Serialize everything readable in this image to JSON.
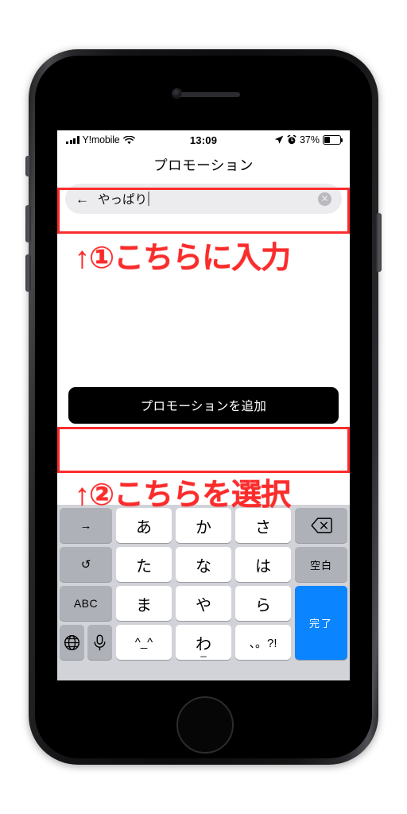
{
  "device": {
    "type": "smartphone-mockup",
    "hardware": {
      "camera": "front-camera",
      "speaker": "earpiece-speaker",
      "home_button": "home-button",
      "silent_switch": "silent-switch",
      "volume_up": "volume-up-button",
      "volume_down": "volume-down-button",
      "power": "power-button"
    }
  },
  "status_bar": {
    "signal_icon": "cellular-signal-icon",
    "carrier": "Y!mobile",
    "wifi_icon": "wifi-icon",
    "time": "13:09",
    "location_icon": "location-arrow-icon",
    "alarm_icon": "alarm-clock-icon",
    "battery_percent": "37%",
    "battery_icon": "battery-icon",
    "battery_level": 37
  },
  "app": {
    "title": "プロモーション"
  },
  "search": {
    "back_icon": "back-arrow-icon",
    "value": "やっぱり",
    "placeholder": "",
    "clear_icon": "clear-circle-icon",
    "clear_glyph": "✕"
  },
  "cta": {
    "label": "プロモーションを追加"
  },
  "annotations": [
    {
      "id": "step-1",
      "text": "↑①こちらに入力",
      "color": "#fb2c2c",
      "target": "search-field"
    },
    {
      "id": "step-2",
      "text": "↑②こちらを選択",
      "color": "#fb2c2c",
      "target": "add-promotion-button"
    }
  ],
  "keyboard": {
    "type": "japanese-kana-12key",
    "left_column": [
      {
        "name": "cursor-right-key",
        "label": "→",
        "style": "dark"
      },
      {
        "name": "undo-key",
        "label": "↺",
        "style": "dark"
      },
      {
        "name": "abc-mode-key",
        "label": "ABC",
        "style": "dark"
      }
    ],
    "bottom_left": [
      {
        "name": "globe-key",
        "label": "🌐",
        "style": "dark"
      },
      {
        "name": "dictation-key",
        "label": "🎤",
        "style": "dark"
      }
    ],
    "center_rows": [
      [
        {
          "name": "kana-a-key",
          "label": "あ"
        },
        {
          "name": "kana-ka-key",
          "label": "か"
        },
        {
          "name": "kana-sa-key",
          "label": "さ"
        }
      ],
      [
        {
          "name": "kana-ta-key",
          "label": "た"
        },
        {
          "name": "kana-na-key",
          "label": "な"
        },
        {
          "name": "kana-ha-key",
          "label": "は"
        }
      ],
      [
        {
          "name": "kana-ma-key",
          "label": "ま"
        },
        {
          "name": "kana-ya-key",
          "label": "や"
        },
        {
          "name": "kana-ra-key",
          "label": "ら"
        }
      ],
      [
        {
          "name": "emoticon-key",
          "label": "^_^"
        },
        {
          "name": "kana-wa-key",
          "label": "わ",
          "sub": "_"
        },
        {
          "name": "punctuation-key",
          "label": "、。?!"
        }
      ]
    ],
    "right_column": [
      {
        "name": "backspace-key",
        "label": "⌫",
        "style": "dark"
      },
      {
        "name": "space-key",
        "label": "空白",
        "style": "dark"
      },
      {
        "name": "done-key",
        "label": "完了",
        "style": "blue"
      }
    ]
  },
  "colors": {
    "accent_blue": "#0a84ff",
    "annotation_red": "#fb2c2c",
    "keyboard_bg": "#d1d3d9",
    "key_dark": "#aeb1b8",
    "key_light": "#ffffff",
    "cta_bg": "#000000",
    "search_bg": "#ececee"
  }
}
